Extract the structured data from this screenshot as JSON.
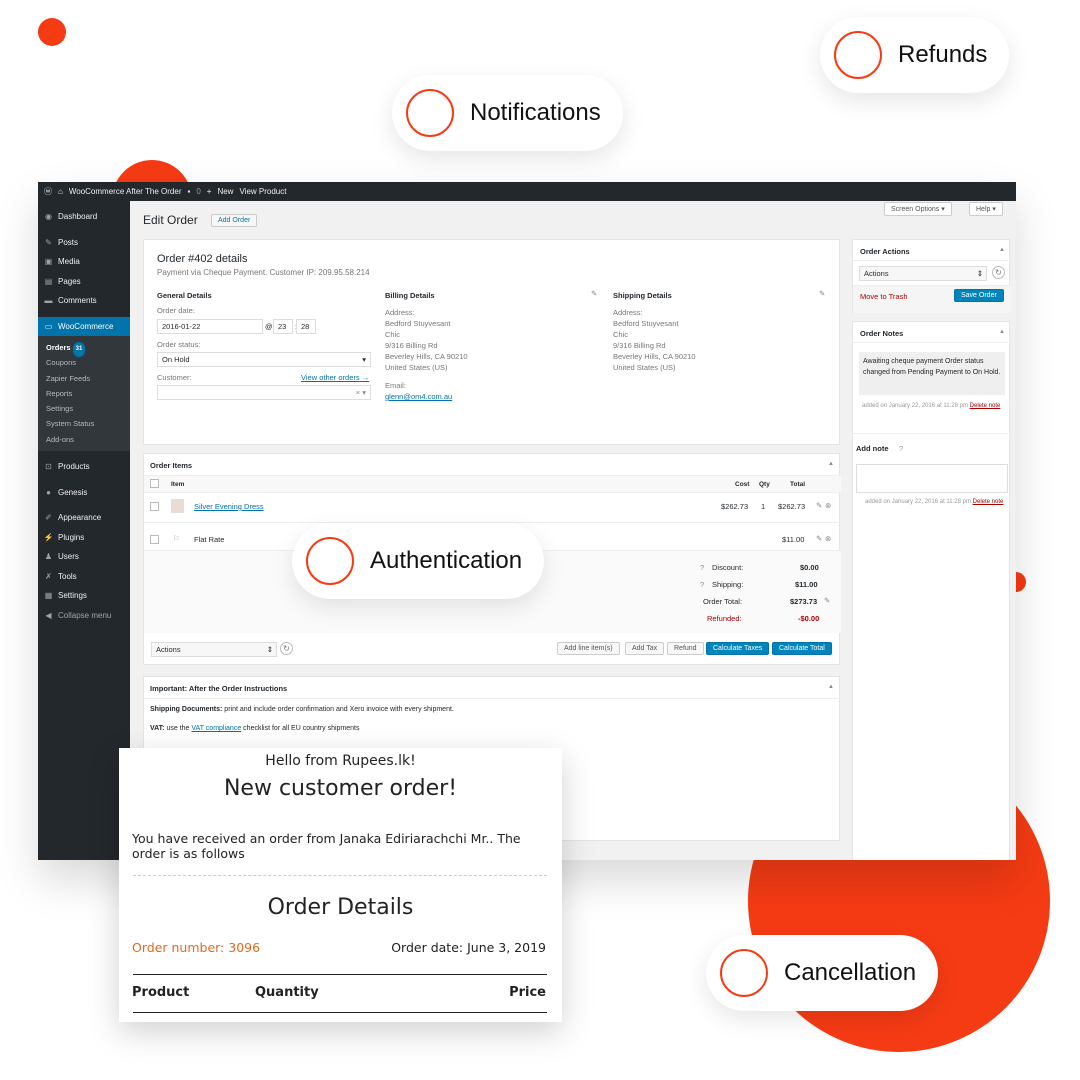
{
  "pills": {
    "refunds": "Refunds",
    "notifications": "Notifications",
    "authentication": "Authentication",
    "cancellation": "Cancellation"
  },
  "colors": {
    "accent": "#f53b14",
    "wp_blue": "#0073aa",
    "wp_dark": "#23282d"
  },
  "adminbar": {
    "site": "WooCommerce After The Order",
    "comments": "0",
    "new": "New",
    "view_product": "View Product"
  },
  "sidebar": {
    "dashboard": "Dashboard",
    "posts": "Posts",
    "media": "Media",
    "pages": "Pages",
    "comments": "Comments",
    "woocommerce": "WooCommerce",
    "orders": "Orders",
    "orders_badge": "31",
    "sub": [
      "Coupons",
      "Zapier Feeds",
      "Reports",
      "Settings",
      "System Status",
      "Add-ons"
    ],
    "products": "Products",
    "genesis": "Genesis",
    "appearance": "Appearance",
    "plugins": "Plugins",
    "users": "Users",
    "tools": "Tools",
    "settings": "Settings",
    "collapse": "Collapse menu"
  },
  "header": {
    "title": "Edit Order",
    "add_order": "Add Order",
    "screen_options": "Screen Options",
    "help": "Help"
  },
  "order": {
    "title": "Order #402 details",
    "subtitle": "Payment via Cheque Payment. Customer IP: 209.95.58.214",
    "general_details": "General Details",
    "order_date_label": "Order date:",
    "order_date": "2016-01-22",
    "at": "@",
    "hour": "23",
    "minute": "28",
    "status_label": "Order status:",
    "status": "On Hold",
    "customer_label": "Customer:",
    "view_other": "View other orders →",
    "billing_title": "Billing Details",
    "address_label": "Address:",
    "billing_address": [
      "Bedford Stuyvesant",
      "Chic",
      "9/316 Billing Rd",
      "Beverley Hills, CA 90210",
      "United States (US)"
    ],
    "email_label": "Email:",
    "email": "glenn@om4.com.au",
    "shipping_title": "Shipping Details",
    "shipping_address": [
      "Bedford Stuyvesant",
      "Chic",
      "9/316 Billing Rd",
      "Beverley Hills, CA 90210",
      "United States (US)"
    ]
  },
  "items": {
    "title": "Order Items",
    "col_item": "Item",
    "col_cost": "Cost",
    "col_qty": "Qty",
    "col_total": "Total",
    "product_name": "Silver Evening Dress",
    "product_cost": "$262.73",
    "product_qty": "1",
    "product_total": "$262.73",
    "shipping_name": "Flat Rate",
    "shipping_total": "$11.00",
    "discount_label": "Discount:",
    "discount": "$0.00",
    "shipping_label": "Shipping:",
    "shipping": "$11.00",
    "order_total_label": "Order Total:",
    "order_total": "$273.73",
    "refunded_label": "Refunded:",
    "refunded": "-$0.00",
    "actions": "Actions",
    "add_line": "Add line item(s)",
    "add_tax": "Add Tax",
    "refund": "Refund",
    "calc_taxes": "Calculate Taxes",
    "calc_total": "Calculate Total"
  },
  "instructions": {
    "title": "Important: After the Order Instructions",
    "line1_label": "Shipping Documents:",
    "line1": "print and include order confirmation and Xero invoice with every shipment.",
    "line2_label": "VAT:",
    "line2_pre": "use the",
    "line2_link": "VAT compliance",
    "line2_post": "checklist for all EU country shipments"
  },
  "order_actions": {
    "title": "Order Actions",
    "select": "Actions",
    "trash": "Move to Trash",
    "save": "Save Order"
  },
  "notes": {
    "title": "Order Notes",
    "note_text": "Awaiting cheque payment Order status changed from Pending Payment to On Hold.",
    "note_meta": "added on January 22, 2016 at 11:28 pm",
    "delete": "Delete note",
    "add_note": "Add note",
    "note_meta2": "added on January 22, 2016 at 11:28 pm",
    "delete2": "Delete note"
  },
  "email": {
    "hello": "Hello from Rupees.lk!",
    "heading": "New customer order!",
    "body": "You have received an order from Janaka Ediriarachchi Mr.. The order is as follows",
    "details_title": "Order Details",
    "order_number": "Order number: 3096",
    "order_date": "Order date: June 3, 2019",
    "col_product": "Product",
    "col_quantity": "Quantity",
    "col_price": "Price"
  }
}
